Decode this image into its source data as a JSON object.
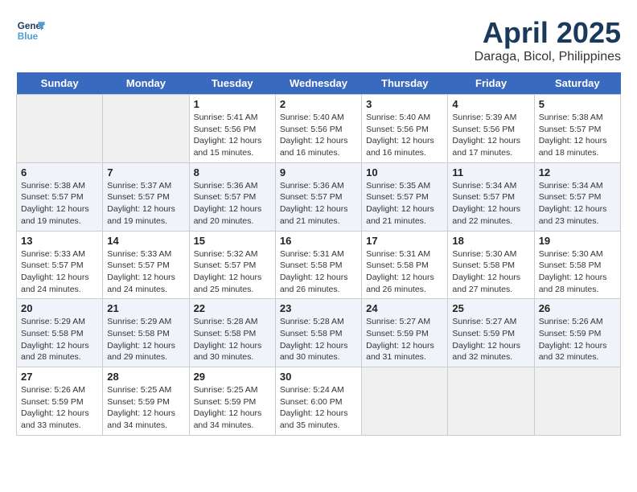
{
  "logo": {
    "line1": "General",
    "line2": "Blue"
  },
  "title": "April 2025",
  "subtitle": "Daraga, Bicol, Philippines",
  "headers": [
    "Sunday",
    "Monday",
    "Tuesday",
    "Wednesday",
    "Thursday",
    "Friday",
    "Saturday"
  ],
  "weeks": [
    [
      {
        "day": "",
        "sunrise": "",
        "sunset": "",
        "daylight": ""
      },
      {
        "day": "",
        "sunrise": "",
        "sunset": "",
        "daylight": ""
      },
      {
        "day": "1",
        "sunrise": "Sunrise: 5:41 AM",
        "sunset": "Sunset: 5:56 PM",
        "daylight": "Daylight: 12 hours and 15 minutes."
      },
      {
        "day": "2",
        "sunrise": "Sunrise: 5:40 AM",
        "sunset": "Sunset: 5:56 PM",
        "daylight": "Daylight: 12 hours and 16 minutes."
      },
      {
        "day": "3",
        "sunrise": "Sunrise: 5:40 AM",
        "sunset": "Sunset: 5:56 PM",
        "daylight": "Daylight: 12 hours and 16 minutes."
      },
      {
        "day": "4",
        "sunrise": "Sunrise: 5:39 AM",
        "sunset": "Sunset: 5:56 PM",
        "daylight": "Daylight: 12 hours and 17 minutes."
      },
      {
        "day": "5",
        "sunrise": "Sunrise: 5:38 AM",
        "sunset": "Sunset: 5:57 PM",
        "daylight": "Daylight: 12 hours and 18 minutes."
      }
    ],
    [
      {
        "day": "6",
        "sunrise": "Sunrise: 5:38 AM",
        "sunset": "Sunset: 5:57 PM",
        "daylight": "Daylight: 12 hours and 19 minutes."
      },
      {
        "day": "7",
        "sunrise": "Sunrise: 5:37 AM",
        "sunset": "Sunset: 5:57 PM",
        "daylight": "Daylight: 12 hours and 19 minutes."
      },
      {
        "day": "8",
        "sunrise": "Sunrise: 5:36 AM",
        "sunset": "Sunset: 5:57 PM",
        "daylight": "Daylight: 12 hours and 20 minutes."
      },
      {
        "day": "9",
        "sunrise": "Sunrise: 5:36 AM",
        "sunset": "Sunset: 5:57 PM",
        "daylight": "Daylight: 12 hours and 21 minutes."
      },
      {
        "day": "10",
        "sunrise": "Sunrise: 5:35 AM",
        "sunset": "Sunset: 5:57 PM",
        "daylight": "Daylight: 12 hours and 21 minutes."
      },
      {
        "day": "11",
        "sunrise": "Sunrise: 5:34 AM",
        "sunset": "Sunset: 5:57 PM",
        "daylight": "Daylight: 12 hours and 22 minutes."
      },
      {
        "day": "12",
        "sunrise": "Sunrise: 5:34 AM",
        "sunset": "Sunset: 5:57 PM",
        "daylight": "Daylight: 12 hours and 23 minutes."
      }
    ],
    [
      {
        "day": "13",
        "sunrise": "Sunrise: 5:33 AM",
        "sunset": "Sunset: 5:57 PM",
        "daylight": "Daylight: 12 hours and 24 minutes."
      },
      {
        "day": "14",
        "sunrise": "Sunrise: 5:33 AM",
        "sunset": "Sunset: 5:57 PM",
        "daylight": "Daylight: 12 hours and 24 minutes."
      },
      {
        "day": "15",
        "sunrise": "Sunrise: 5:32 AM",
        "sunset": "Sunset: 5:57 PM",
        "daylight": "Daylight: 12 hours and 25 minutes."
      },
      {
        "day": "16",
        "sunrise": "Sunrise: 5:31 AM",
        "sunset": "Sunset: 5:58 PM",
        "daylight": "Daylight: 12 hours and 26 minutes."
      },
      {
        "day": "17",
        "sunrise": "Sunrise: 5:31 AM",
        "sunset": "Sunset: 5:58 PM",
        "daylight": "Daylight: 12 hours and 26 minutes."
      },
      {
        "day": "18",
        "sunrise": "Sunrise: 5:30 AM",
        "sunset": "Sunset: 5:58 PM",
        "daylight": "Daylight: 12 hours and 27 minutes."
      },
      {
        "day": "19",
        "sunrise": "Sunrise: 5:30 AM",
        "sunset": "Sunset: 5:58 PM",
        "daylight": "Daylight: 12 hours and 28 minutes."
      }
    ],
    [
      {
        "day": "20",
        "sunrise": "Sunrise: 5:29 AM",
        "sunset": "Sunset: 5:58 PM",
        "daylight": "Daylight: 12 hours and 28 minutes."
      },
      {
        "day": "21",
        "sunrise": "Sunrise: 5:29 AM",
        "sunset": "Sunset: 5:58 PM",
        "daylight": "Daylight: 12 hours and 29 minutes."
      },
      {
        "day": "22",
        "sunrise": "Sunrise: 5:28 AM",
        "sunset": "Sunset: 5:58 PM",
        "daylight": "Daylight: 12 hours and 30 minutes."
      },
      {
        "day": "23",
        "sunrise": "Sunrise: 5:28 AM",
        "sunset": "Sunset: 5:58 PM",
        "daylight": "Daylight: 12 hours and 30 minutes."
      },
      {
        "day": "24",
        "sunrise": "Sunrise: 5:27 AM",
        "sunset": "Sunset: 5:59 PM",
        "daylight": "Daylight: 12 hours and 31 minutes."
      },
      {
        "day": "25",
        "sunrise": "Sunrise: 5:27 AM",
        "sunset": "Sunset: 5:59 PM",
        "daylight": "Daylight: 12 hours and 32 minutes."
      },
      {
        "day": "26",
        "sunrise": "Sunrise: 5:26 AM",
        "sunset": "Sunset: 5:59 PM",
        "daylight": "Daylight: 12 hours and 32 minutes."
      }
    ],
    [
      {
        "day": "27",
        "sunrise": "Sunrise: 5:26 AM",
        "sunset": "Sunset: 5:59 PM",
        "daylight": "Daylight: 12 hours and 33 minutes."
      },
      {
        "day": "28",
        "sunrise": "Sunrise: 5:25 AM",
        "sunset": "Sunset: 5:59 PM",
        "daylight": "Daylight: 12 hours and 34 minutes."
      },
      {
        "day": "29",
        "sunrise": "Sunrise: 5:25 AM",
        "sunset": "Sunset: 5:59 PM",
        "daylight": "Daylight: 12 hours and 34 minutes."
      },
      {
        "day": "30",
        "sunrise": "Sunrise: 5:24 AM",
        "sunset": "Sunset: 6:00 PM",
        "daylight": "Daylight: 12 hours and 35 minutes."
      },
      {
        "day": "",
        "sunrise": "",
        "sunset": "",
        "daylight": ""
      },
      {
        "day": "",
        "sunrise": "",
        "sunset": "",
        "daylight": ""
      },
      {
        "day": "",
        "sunrise": "",
        "sunset": "",
        "daylight": ""
      }
    ]
  ]
}
